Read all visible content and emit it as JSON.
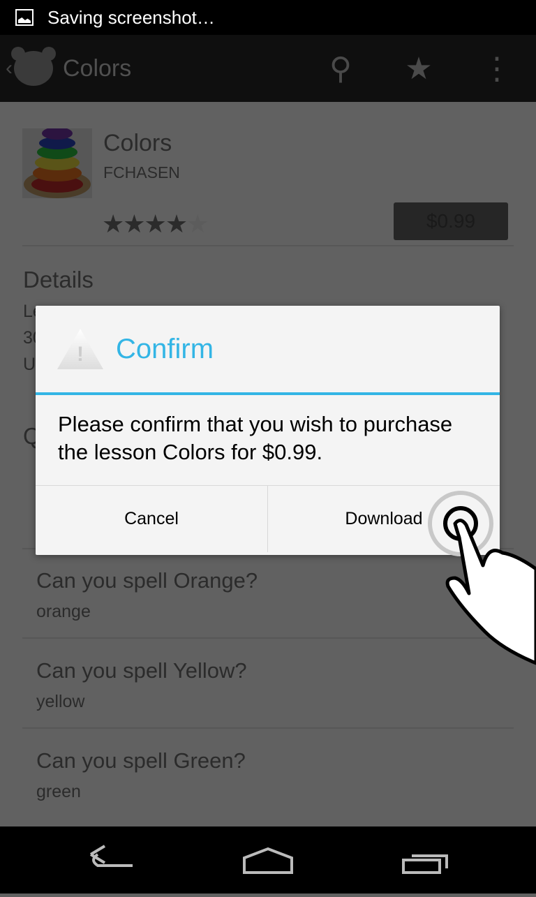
{
  "status_bar": {
    "notification": "Saving screenshot…",
    "icon": "image-icon"
  },
  "action_bar": {
    "title": "Colors",
    "icons": [
      "back-chevron-icon",
      "bear-logo-icon",
      "search-icon",
      "star-icon",
      "overflow-menu-icon"
    ]
  },
  "lesson": {
    "name": "Colors",
    "author": "FCHASEN",
    "rating": 4,
    "rating_max": 5,
    "price": "$0.99"
  },
  "details": {
    "heading": "Details",
    "fragments": [
      "Le",
      "30",
      "U"
    ],
    "section_fragment": "Q"
  },
  "questions": [
    {
      "question": "Can you spell Orange?",
      "answer": "orange"
    },
    {
      "question": "Can you spell Yellow?",
      "answer": "yellow"
    },
    {
      "question": "Can you spell Green?",
      "answer": "green"
    }
  ],
  "dialog": {
    "title": "Confirm",
    "icon": "warning-icon",
    "message": "Please confirm that you wish to purchase the lesson Colors for $0.99.",
    "cancel": "Cancel",
    "confirm": "Download",
    "accent": "#33b5e5"
  },
  "nav_bar": {
    "icons": [
      "back-icon",
      "home-icon",
      "recent-apps-icon"
    ]
  }
}
